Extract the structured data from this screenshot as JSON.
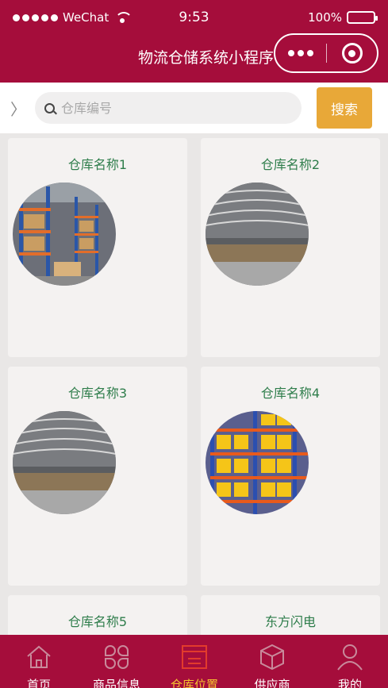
{
  "status_bar": {
    "carrier": "WeChat",
    "time": "9:53",
    "battery": "100%"
  },
  "header": {
    "title": "物流仓储系统小程序"
  },
  "search": {
    "placeholder": "仓库编号",
    "button_label": "搜索"
  },
  "warehouses": [
    {
      "name": "仓库名称1"
    },
    {
      "name": "仓库名称2"
    },
    {
      "name": "仓库名称3"
    },
    {
      "name": "仓库名称4"
    },
    {
      "name": "仓库名称5"
    },
    {
      "name": "东方闪电"
    }
  ],
  "tabbar": {
    "items": [
      {
        "label": "首页",
        "icon": "home-icon"
      },
      {
        "label": "商品信息",
        "icon": "grid-icon"
      },
      {
        "label": "仓库位置",
        "icon": "warehouse-icon",
        "active": true
      },
      {
        "label": "供应商",
        "icon": "box-icon"
      },
      {
        "label": "我的",
        "icon": "user-icon"
      }
    ]
  },
  "colors": {
    "brand": "#a50d3b",
    "accent": "#e8a838",
    "active_tab": "#f5c330",
    "card_title": "#2e7d4b"
  }
}
